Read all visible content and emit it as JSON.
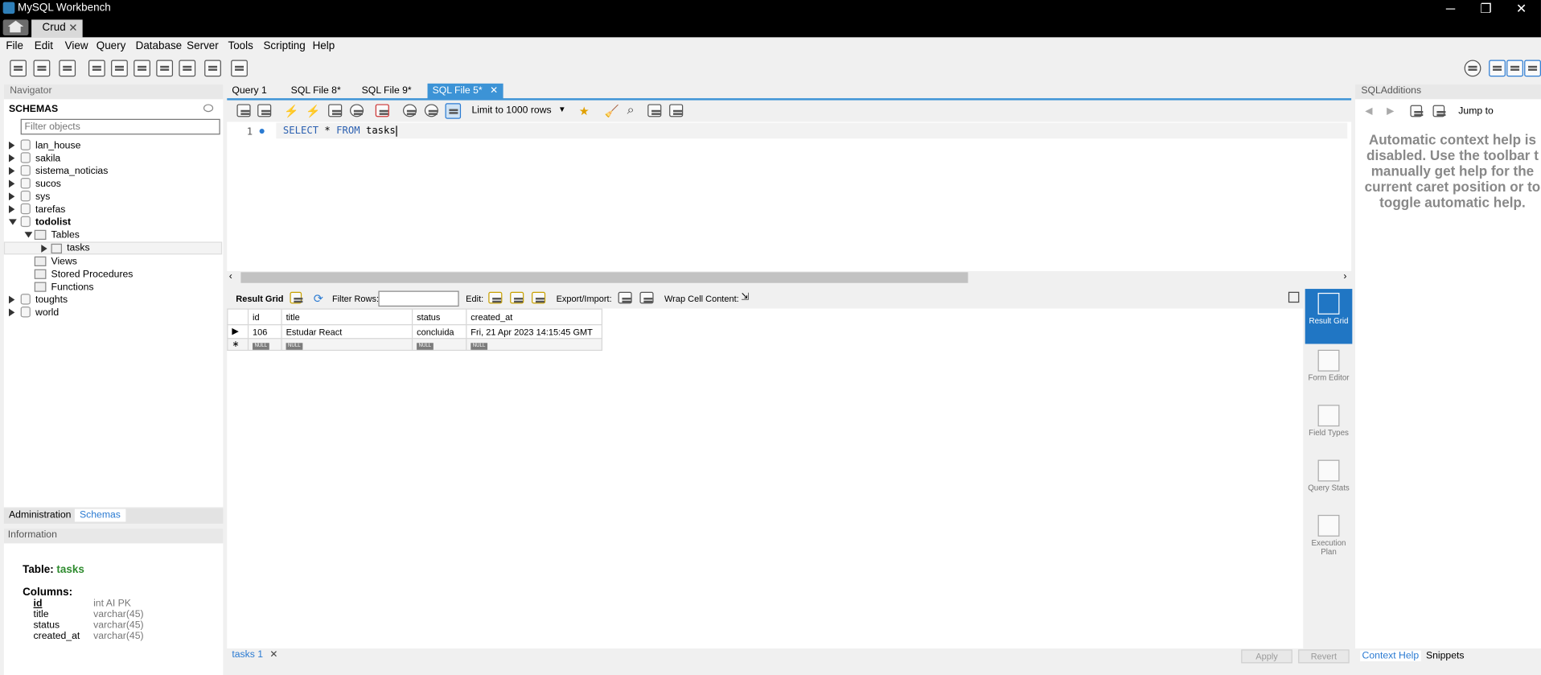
{
  "window": {
    "app_title": "MySQL Workbench",
    "connection_tab": "Crud",
    "close_glyph": "✕",
    "minimize_glyph": "─",
    "restore_glyph": "❐"
  },
  "menu": [
    "File",
    "Edit",
    "View",
    "Query",
    "Database",
    "Server",
    "Tools",
    "Scripting",
    "Help"
  ],
  "navigator": {
    "header": "Navigator",
    "schemas_title": "SCHEMAS",
    "filter_placeholder": "Filter objects",
    "schemas": [
      "lan_house",
      "sakila",
      "sistema_noticias",
      "sucos",
      "sys",
      "tarefas",
      "todolist",
      "toughts",
      "world"
    ],
    "expanded_schema": "todolist",
    "children": {
      "tables": "Tables",
      "table_item": "tasks",
      "views": "Views",
      "stored_procedures": "Stored Procedures",
      "functions": "Functions"
    },
    "bottom_tabs": [
      "Administration",
      "Schemas"
    ],
    "active_bottom_tab": "Schemas"
  },
  "information": {
    "header": "Information",
    "table_label": "Table:",
    "table_name": "tasks",
    "columns_label": "Columns:",
    "columns": [
      {
        "name": "id",
        "type": "int AI PK"
      },
      {
        "name": "title",
        "type": "varchar(45)"
      },
      {
        "name": "status",
        "type": "varchar(45)"
      },
      {
        "name": "created_at",
        "type": "varchar(45)"
      }
    ]
  },
  "editor_tabs": [
    {
      "label": "Query 1",
      "active": false
    },
    {
      "label": "SQL File 8*",
      "active": false
    },
    {
      "label": "SQL File 9*",
      "active": false
    },
    {
      "label": "SQL File 5*",
      "active": true
    }
  ],
  "editor": {
    "limit_select": "Limit to 1000 rows",
    "line_number": "1",
    "code_keyword_select": "SELECT",
    "code_star": "*",
    "code_keyword_from": "FROM",
    "code_table": "tasks"
  },
  "result_toolbar": {
    "result_grid": "Result Grid",
    "filter_rows": "Filter Rows:",
    "edit": "Edit:",
    "export_import": "Export/Import:",
    "wrap_cell": "Wrap Cell Content:"
  },
  "grid": {
    "columns": [
      "id",
      "title",
      "status",
      "created_at"
    ],
    "rows": [
      [
        "106",
        "Estudar React",
        "concluida",
        "Fri, 21 Apr 2023 14:15:45 GMT"
      ]
    ],
    "null_label": "NULL"
  },
  "side_rail": [
    "Result Grid",
    "Form Editor",
    "Field Types",
    "Query Stats",
    "Execution Plan"
  ],
  "footer": {
    "result_tab": "tasks 1",
    "apply": "Apply",
    "revert": "Revert"
  },
  "sql_additions": {
    "header": "SQLAdditions",
    "jump_to": "Jump to",
    "help_text": "Automatic context help is\ndisabled. Use the toolbar t\nmanually get help for the\ncurrent caret position or to\ntoggle automatic help.",
    "tabs": [
      "Context Help",
      "Snippets"
    ]
  },
  "colors": {
    "accent": "#3c93d6",
    "table_name_green": "#2e8b2e"
  }
}
